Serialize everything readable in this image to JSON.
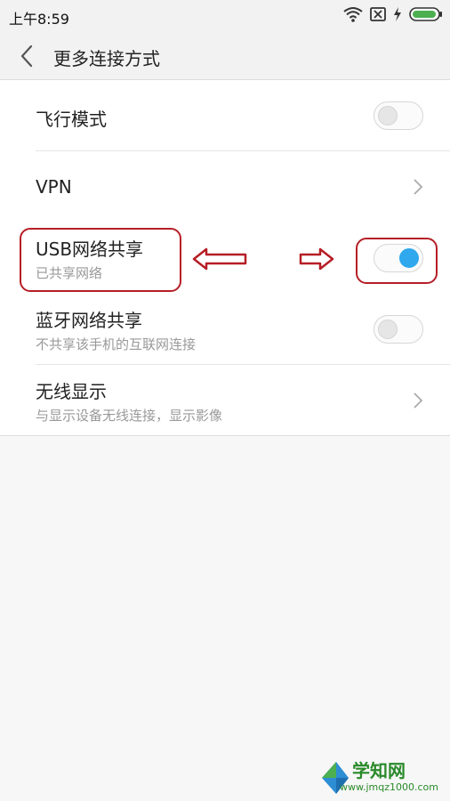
{
  "status_bar": {
    "time": "上午8:59",
    "icons": [
      "wifi-icon",
      "sim-disabled-icon",
      "charging-icon",
      "battery-icon"
    ]
  },
  "header": {
    "title": "更多连接方式"
  },
  "settings": [
    {
      "label": "飞行模式",
      "subtitle": "",
      "control": "toggle",
      "on": false
    },
    {
      "label": "VPN",
      "subtitle": "",
      "control": "chevron"
    },
    {
      "label": "USB网络共享",
      "subtitle": "已共享网络",
      "control": "toggle",
      "on": true
    },
    {
      "label": "蓝牙网络共享",
      "subtitle": "不共享该手机的互联网连接",
      "control": "toggle",
      "on": false
    },
    {
      "label": "无线显示",
      "subtitle": "与显示设备无线连接，显示影像",
      "control": "chevron"
    }
  ],
  "watermark": {
    "title": "学知网",
    "url": "www.jmqz1000.com"
  },
  "colors": {
    "accent": "#2fa8ee",
    "annotation": "#b61e26",
    "battery": "#4caf50"
  }
}
